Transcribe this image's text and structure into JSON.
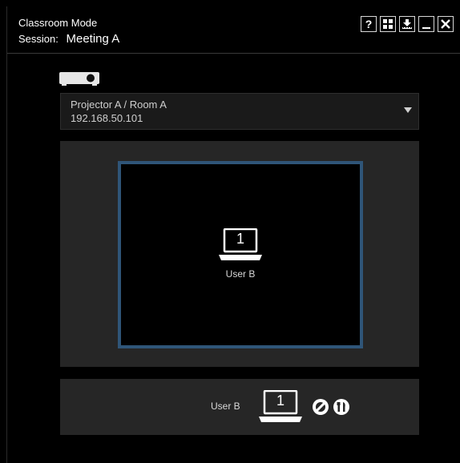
{
  "window": {
    "title": "Classroom Mode",
    "session_label": "Session:",
    "session_value": "Meeting A"
  },
  "toolbar": {
    "help_label": "?",
    "buttons": [
      "help-icon",
      "grid-layout-icon",
      "download-icon",
      "minimize-icon",
      "close-icon"
    ]
  },
  "projector": {
    "icon": "projector-icon",
    "name": "Projector A / Room A",
    "ip": "192.168.50.101"
  },
  "display": {
    "frame_color": "#2f5578",
    "slot_number": "1",
    "user_name": "User B"
  },
  "user_bar": {
    "user_name": "User B",
    "slot_number": "1",
    "actions": [
      "disconnect-icon",
      "tools-icon"
    ]
  }
}
